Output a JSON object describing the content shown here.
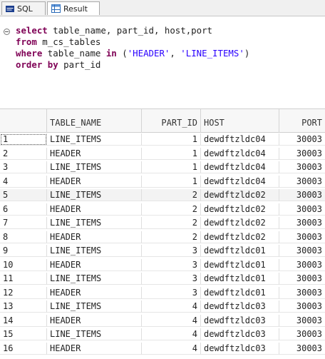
{
  "tabs": {
    "sql_label": "SQL",
    "result_label": "Result"
  },
  "editor": {
    "line1": {
      "kw": "select",
      "rest": " table_name, part_id, host,port"
    },
    "line2": {
      "kw": "from",
      "rest": " m_cs_tables"
    },
    "line3": {
      "kw": "where",
      "mid": " table_name ",
      "kw2": "in",
      "open": " (",
      "s1": "'HEADER'",
      "sep": ", ",
      "s2": "'LINE_ITEMS'",
      "close": ")"
    },
    "line4": {
      "kw": "order by",
      "rest": " part_id"
    }
  },
  "grid": {
    "columns": [
      "",
      "TABLE_NAME",
      "PART_ID",
      "HOST",
      "PORT"
    ],
    "rows": [
      [
        "1",
        "LINE_ITEMS",
        "1",
        "dewdftzldc04",
        "30003"
      ],
      [
        "2",
        "HEADER",
        "1",
        "dewdftzldc04",
        "30003"
      ],
      [
        "3",
        "LINE_ITEMS",
        "1",
        "dewdftzldc04",
        "30003"
      ],
      [
        "4",
        "HEADER",
        "1",
        "dewdftzldc04",
        "30003"
      ],
      [
        "5",
        "LINE_ITEMS",
        "2",
        "dewdftzldc02",
        "30003"
      ],
      [
        "6",
        "HEADER",
        "2",
        "dewdftzldc02",
        "30003"
      ],
      [
        "7",
        "LINE_ITEMS",
        "2",
        "dewdftzldc02",
        "30003"
      ],
      [
        "8",
        "HEADER",
        "2",
        "dewdftzldc02",
        "30003"
      ],
      [
        "9",
        "LINE_ITEMS",
        "3",
        "dewdftzldc01",
        "30003"
      ],
      [
        "10",
        "HEADER",
        "3",
        "dewdftzldc01",
        "30003"
      ],
      [
        "11",
        "LINE_ITEMS",
        "3",
        "dewdftzldc01",
        "30003"
      ],
      [
        "12",
        "HEADER",
        "3",
        "dewdftzldc01",
        "30003"
      ],
      [
        "13",
        "LINE_ITEMS",
        "4",
        "dewdftzldc03",
        "30003"
      ],
      [
        "14",
        "HEADER",
        "4",
        "dewdftzldc03",
        "30003"
      ],
      [
        "15",
        "LINE_ITEMS",
        "4",
        "dewdftzldc03",
        "30003"
      ],
      [
        "16",
        "HEADER",
        "4",
        "dewdftzldc03",
        "30003"
      ]
    ]
  }
}
